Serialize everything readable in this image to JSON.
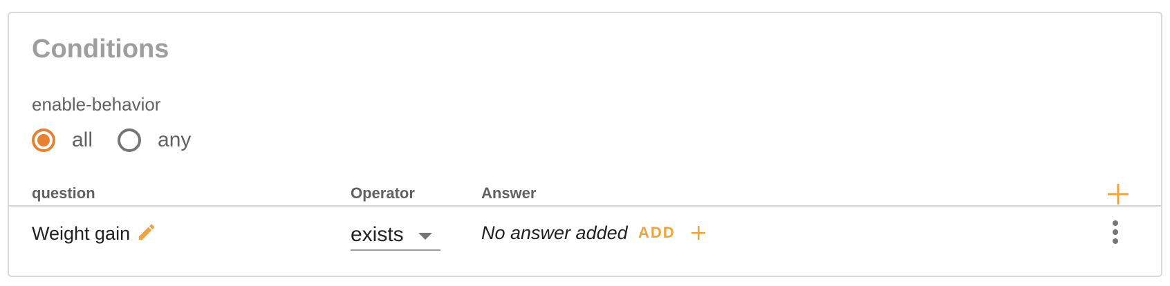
{
  "panel": {
    "title": "Conditions",
    "behavior_label": "enable-behavior",
    "behavior_options": [
      {
        "label": "all",
        "checked": true
      },
      {
        "label": "any",
        "checked": false
      }
    ]
  },
  "table": {
    "headers": {
      "question": "question",
      "operator": "Operator",
      "answer": "Answer"
    },
    "add_icon": "plus-icon",
    "rows": [
      {
        "question": "Weight gain",
        "edit_icon": "pencil-icon",
        "operator": "exists",
        "answer": "No answer added",
        "add_answer_label": "ADD",
        "add_answer_icon": "plus-icon",
        "menu_icon": "more-vertical-icon"
      }
    ]
  },
  "colors": {
    "accent": "#e8812f",
    "accent_light": "#f0a23b",
    "title": "#9e9e9e",
    "muted_text": "#616161",
    "border": "#d9d9d9"
  }
}
